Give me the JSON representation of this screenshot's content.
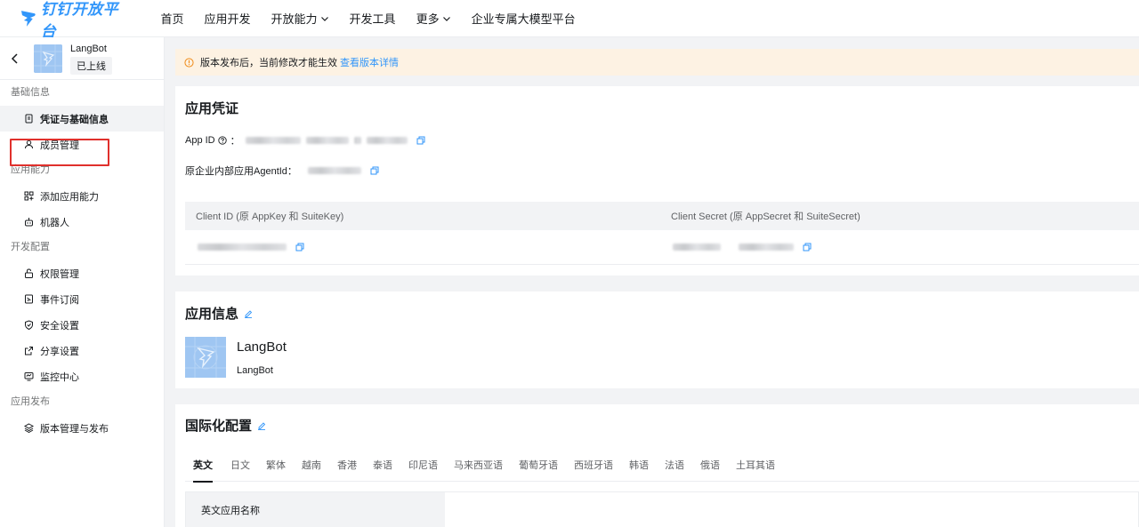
{
  "brand": {
    "name": "钉钉开放平台",
    "color": "#3296fa"
  },
  "topnav": {
    "items": [
      {
        "label": "首页",
        "dropdown": false
      },
      {
        "label": "应用开发",
        "dropdown": false
      },
      {
        "label": "开放能力",
        "dropdown": true
      },
      {
        "label": "开发工具",
        "dropdown": false
      },
      {
        "label": "更多",
        "dropdown": true
      },
      {
        "label": "企业专属大模型平台",
        "dropdown": false
      }
    ]
  },
  "sidebar": {
    "app_name": "LangBot",
    "app_status": "已上线",
    "groups": [
      {
        "title": "基础信息",
        "items": [
          {
            "label": "凭证与基础信息",
            "icon": "document-icon",
            "active": true
          },
          {
            "label": "成员管理",
            "icon": "user-icon",
            "active": false
          }
        ]
      },
      {
        "title": "应用能力",
        "items": [
          {
            "label": "添加应用能力",
            "icon": "grid-plus-icon",
            "active": false
          },
          {
            "label": "机器人",
            "icon": "robot-icon",
            "active": false
          }
        ]
      },
      {
        "title": "开发配置",
        "items": [
          {
            "label": "权限管理",
            "icon": "lock-icon",
            "active": false
          },
          {
            "label": "事件订阅",
            "icon": "event-icon",
            "active": false
          },
          {
            "label": "安全设置",
            "icon": "shield-icon",
            "active": false
          },
          {
            "label": "分享设置",
            "icon": "share-icon",
            "active": false
          },
          {
            "label": "监控中心",
            "icon": "monitor-icon",
            "active": false
          }
        ]
      },
      {
        "title": "应用发布",
        "items": [
          {
            "label": "版本管理与发布",
            "icon": "layers-icon",
            "active": false
          }
        ]
      }
    ]
  },
  "notice": {
    "text": "版本发布后，当前修改才能生效",
    "link": "查看版本详情"
  },
  "credentials": {
    "title": "应用凭证",
    "app_id_label": "App ID",
    "app_id_colon": "：",
    "agent_label": "原企业内部应用AgentId：",
    "client_id_header": "Client ID (原 AppKey 和 SuiteKey)",
    "client_secret_header": "Client Secret (原 AppSecret 和 SuiteSecret)"
  },
  "app_info": {
    "title": "应用信息",
    "name": "LangBot",
    "sub": "LangBot"
  },
  "intl": {
    "title": "国际化配置",
    "tabs": [
      "英文",
      "日文",
      "繁体",
      "越南",
      "香港",
      "泰语",
      "印尼语",
      "马来西亚语",
      "葡萄牙语",
      "西班牙语",
      "韩语",
      "法语",
      "俄语",
      "土耳其语"
    ],
    "active_tab": 0,
    "row_label": "英文应用名称"
  }
}
